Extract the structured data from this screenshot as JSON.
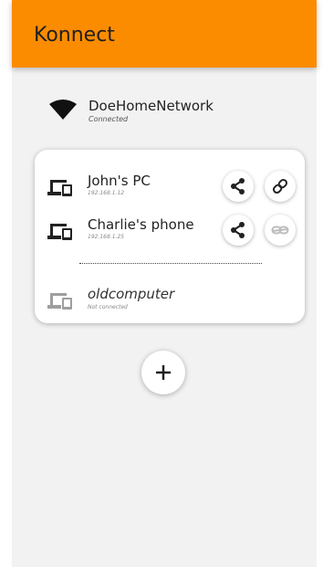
{
  "app": {
    "title": "Konnect"
  },
  "colors": {
    "appbar": "#fb8c00",
    "background": "#f2f2f2",
    "card": "#ffffff",
    "disabled": "#bdbdbd"
  },
  "network": {
    "name": "DoeHomeNetwork",
    "status": "Connected",
    "icon": "wifi-icon"
  },
  "devices": [
    {
      "name": "John's PC",
      "address": "192.168.1.12",
      "connected": true,
      "icon": "devices-icon"
    },
    {
      "name": "Charlie's phone",
      "address": "192.168.1.25",
      "connected": true,
      "icon": "devices-icon"
    },
    {
      "name": "oldcomputer",
      "status": "Not connected",
      "connected": false,
      "icon": "devices-icon"
    }
  ],
  "actions": {
    "share_icon": "share-icon",
    "link_icon": "link-icon",
    "unlink_icon": "link-off-icon",
    "add_icon": "plus-icon"
  }
}
